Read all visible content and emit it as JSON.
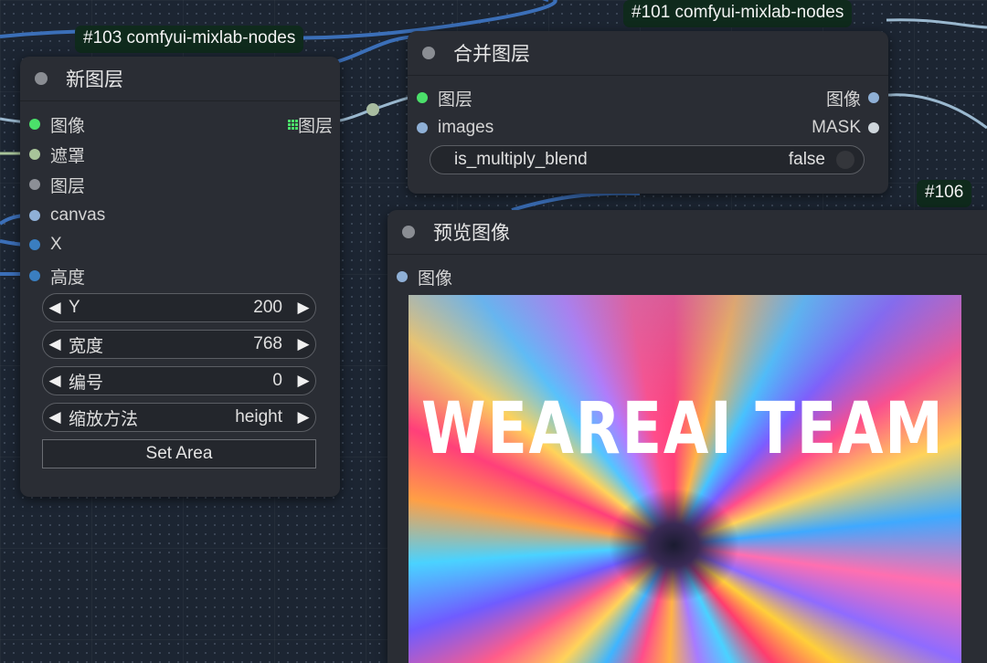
{
  "colors": {
    "canvas_bg": "#1c2532",
    "node_bg": "#2a2d34",
    "badge_bg": "#0f2a1c",
    "wire_blue": "#3b6fb8",
    "wire_pale": "#9ab8cf",
    "slot_green": "#4be06a",
    "slot_olive": "#a8c49a",
    "slot_gray": "#8c8f96",
    "slot_lightblue": "#8fb0d6",
    "slot_darkblue": "#3a7ec0",
    "slot_white": "#cfd6dc"
  },
  "node_103": {
    "badge": "#103 comfyui-mixlab-nodes",
    "title": "新图层",
    "inputs": [
      {
        "label": "图像",
        "color": "green"
      },
      {
        "label": "遮罩",
        "color": "olive"
      },
      {
        "label": "图层",
        "color": "gray"
      },
      {
        "label": "canvas",
        "color": "lightblue"
      },
      {
        "label": "X",
        "color": "darkblue"
      },
      {
        "label": "高度",
        "color": "darkblue"
      }
    ],
    "output": {
      "label": "图层",
      "icon": "grid-icon"
    },
    "widgets": [
      {
        "label": "Y",
        "value": "200"
      },
      {
        "label": "宽度",
        "value": "768"
      },
      {
        "label": "编号",
        "value": "0"
      },
      {
        "label": "缩放方法",
        "value": "height"
      }
    ],
    "button": "Set Area"
  },
  "node_101": {
    "badge": "#101 comfyui-mixlab-nodes",
    "title": "合并图层",
    "inputs": [
      {
        "label": "图层",
        "color": "green"
      },
      {
        "label": "images",
        "color": "lightblue"
      }
    ],
    "outputs": [
      {
        "label": "图像",
        "color": "lightblue"
      },
      {
        "label": "MASK",
        "color": "white"
      }
    ],
    "toggle": {
      "label": "is_multiply_blend",
      "value": "false"
    }
  },
  "node_106": {
    "badge": "#106",
    "title": "预览图像",
    "input": {
      "label": "图像",
      "color": "lightblue"
    },
    "image_text": "WEAREAI TEAM"
  }
}
